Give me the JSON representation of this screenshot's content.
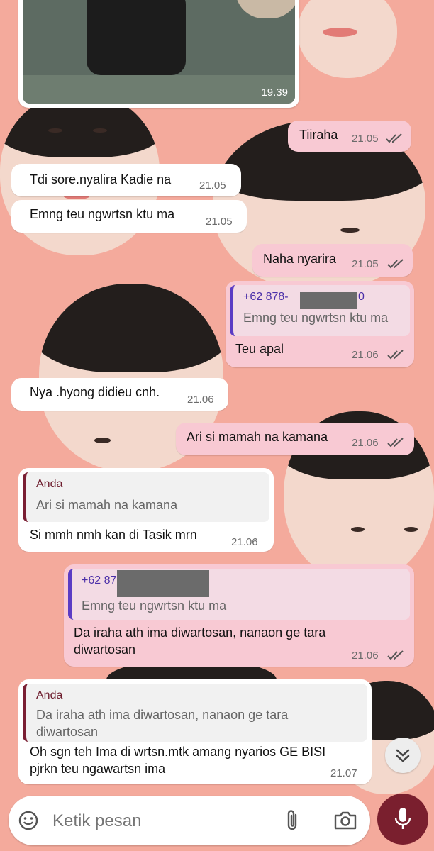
{
  "colors": {
    "wallpaper": "#f4aa9c",
    "outgoing_bubble": "#f8c9d3",
    "incoming_bubble": "#ffffff",
    "outgoing_quote_accent": "#5b3cc4",
    "incoming_quote_accent": "#7a1f33",
    "mic_button": "#7a1f2e"
  },
  "media_message": {
    "time": "19.39"
  },
  "messages": [
    {
      "dir": "out",
      "text": "Tiiraha",
      "time": "21.05"
    },
    {
      "dir": "in",
      "text": "Tdi sore.nyalira Kadie na",
      "time": "21.05"
    },
    {
      "dir": "in",
      "text": "Emng teu ngwrtsn ktu ma",
      "time": "21.05"
    },
    {
      "dir": "out",
      "text": "Naha nyarira",
      "time": "21.05"
    },
    {
      "dir": "out",
      "quote_name": "+62 878-",
      "quote_name_end": "0",
      "quote_text": "Emng teu ngwrtsn ktu ma",
      "text": "Teu apal",
      "time": "21.06"
    },
    {
      "dir": "in",
      "text": "Nya .hyong didieu cnh.",
      "time": "21.06"
    },
    {
      "dir": "out",
      "text": "Ari si mamah na kamana",
      "time": "21.06"
    },
    {
      "dir": "in",
      "quote_name": "Anda",
      "quote_text": "Ari si mamah na kamana",
      "text": "Si mmh nmh kan di Tasik mrn",
      "time": "21.06"
    },
    {
      "dir": "out",
      "quote_name": "+62 87",
      "quote_text": "Emng teu ngwrtsn ktu ma",
      "text_line1": "Da iraha ath ima diwartosan, nanaon ge tara",
      "text_line2": "diwartosan",
      "time": "21.06"
    },
    {
      "dir": "in",
      "quote_name": "Anda",
      "quote_line1": "Da iraha ath ima diwartosan, nanaon ge tara",
      "quote_line2": "diwartosan",
      "text_line1": "Oh sgn teh Ima di wrtsn.mtk amang nyarios GE BISI",
      "text_line2": "pjrkn teu ngawartsn ima",
      "time": "21.07"
    }
  ],
  "input": {
    "placeholder": "Ketik pesan"
  },
  "icons": {
    "emoji": "emoji-icon",
    "attach": "paperclip-icon",
    "camera": "camera-icon",
    "mic": "microphone-icon",
    "scroll": "double-chevron-down-icon",
    "read": "double-check-icon"
  }
}
